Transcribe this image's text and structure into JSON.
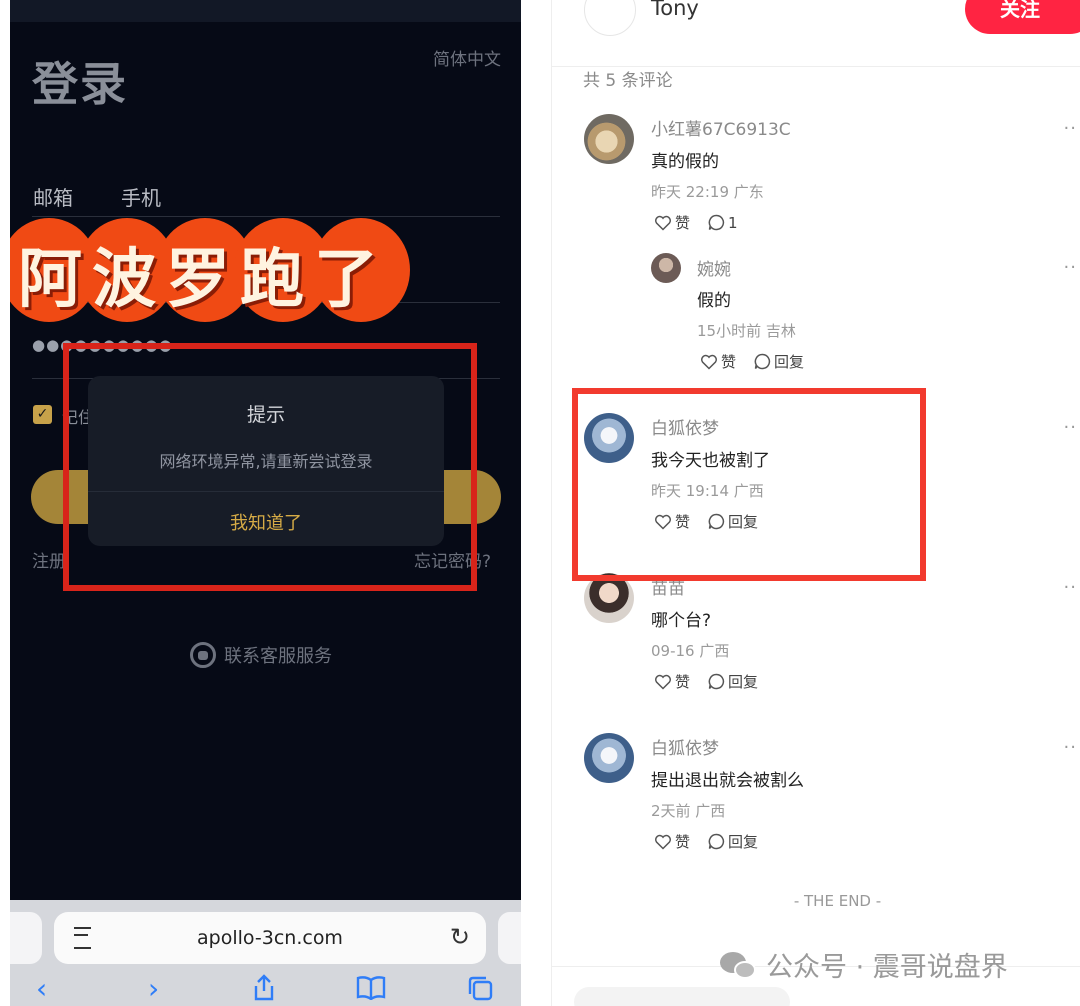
{
  "left_phone": {
    "language": "简体中文",
    "title": "登录",
    "tabs": [
      "邮箱",
      "手机"
    ],
    "password_mask": "●●●●●●●●●●",
    "remember_label": "记住",
    "register": "注册",
    "forgot": "忘记密码?",
    "support": "联系客服服务",
    "banner_text": "阿波罗跑了",
    "dialog": {
      "title": "提示",
      "message": "网络环境异常,请重新尝试登录",
      "button": "我知道了"
    },
    "browser": {
      "url": "apollo-3cn.com",
      "nav_icons": [
        "back-icon",
        "forward-icon",
        "share-icon",
        "bookmarks-icon",
        "tabs-icon"
      ]
    }
  },
  "right_panel": {
    "author": "Tony",
    "follow": "关注",
    "comment_count": "共 5 条评论",
    "like_label": "赞",
    "reply_label": "回复",
    "comments": [
      {
        "name": "小红薯67C6913C",
        "text": "真的假的",
        "meta": "昨天 22:19 广东",
        "reply": "1"
      },
      {
        "name": "婉婉",
        "text": "假的",
        "meta": "15小时前 吉林",
        "reply": "回复"
      },
      {
        "name": "白狐依梦",
        "text": "我今天也被割了",
        "meta": "昨天 19:14 广西",
        "reply": "回复"
      },
      {
        "name": "苗苗",
        "text": "哪个台?",
        "meta": "09-16 广西",
        "reply": "回复"
      },
      {
        "name": "白狐依梦",
        "text": "提出退出就会被割么",
        "meta": "2天前 广西",
        "reply": "回复"
      }
    ],
    "end": "- THE END -",
    "watermark": "公众号 · 震哥说盘界",
    "colors": {
      "accent": "#ff2442",
      "highlight": "#f23a2e"
    }
  }
}
